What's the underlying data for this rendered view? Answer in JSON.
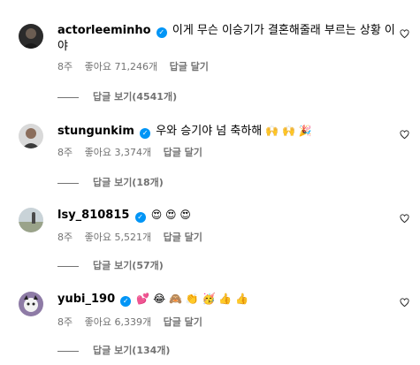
{
  "comments": [
    {
      "username": "actorleeminho",
      "text": "이게 무슨 이승기가 결혼해줄래 부르는 상황 이야",
      "age": "8주",
      "likes": "좋아요 71,246개",
      "reply": "답글 달기",
      "view_replies": "답글 보기(4541개)"
    },
    {
      "username": "stungunkim",
      "text": "우와 승기야 넘 축하해",
      "emojis": "🙌 🙌 🎉",
      "age": "8주",
      "likes": "좋아요 3,374개",
      "reply": "답글 달기",
      "view_replies": "답글 보기(18개)"
    },
    {
      "username": "lsy_810815",
      "emojis": "😍 😍 😍",
      "age": "8주",
      "likes": "좋아요 5,521개",
      "reply": "답글 달기",
      "view_replies": "답글 보기(57개)"
    },
    {
      "username": "yubi_190",
      "emojis": "💕 😂 🙈 👏 🥳 👍 👍",
      "age": "8주",
      "likes": "좋아요 6,339개",
      "reply": "답글 달기",
      "view_replies": "답글 보기(134개)"
    }
  ],
  "colors": {
    "verified": "#0095f6",
    "secondary_text": "#737373"
  },
  "icons": {
    "verified": "verified-badge-icon",
    "like": "heart-outline-icon"
  }
}
